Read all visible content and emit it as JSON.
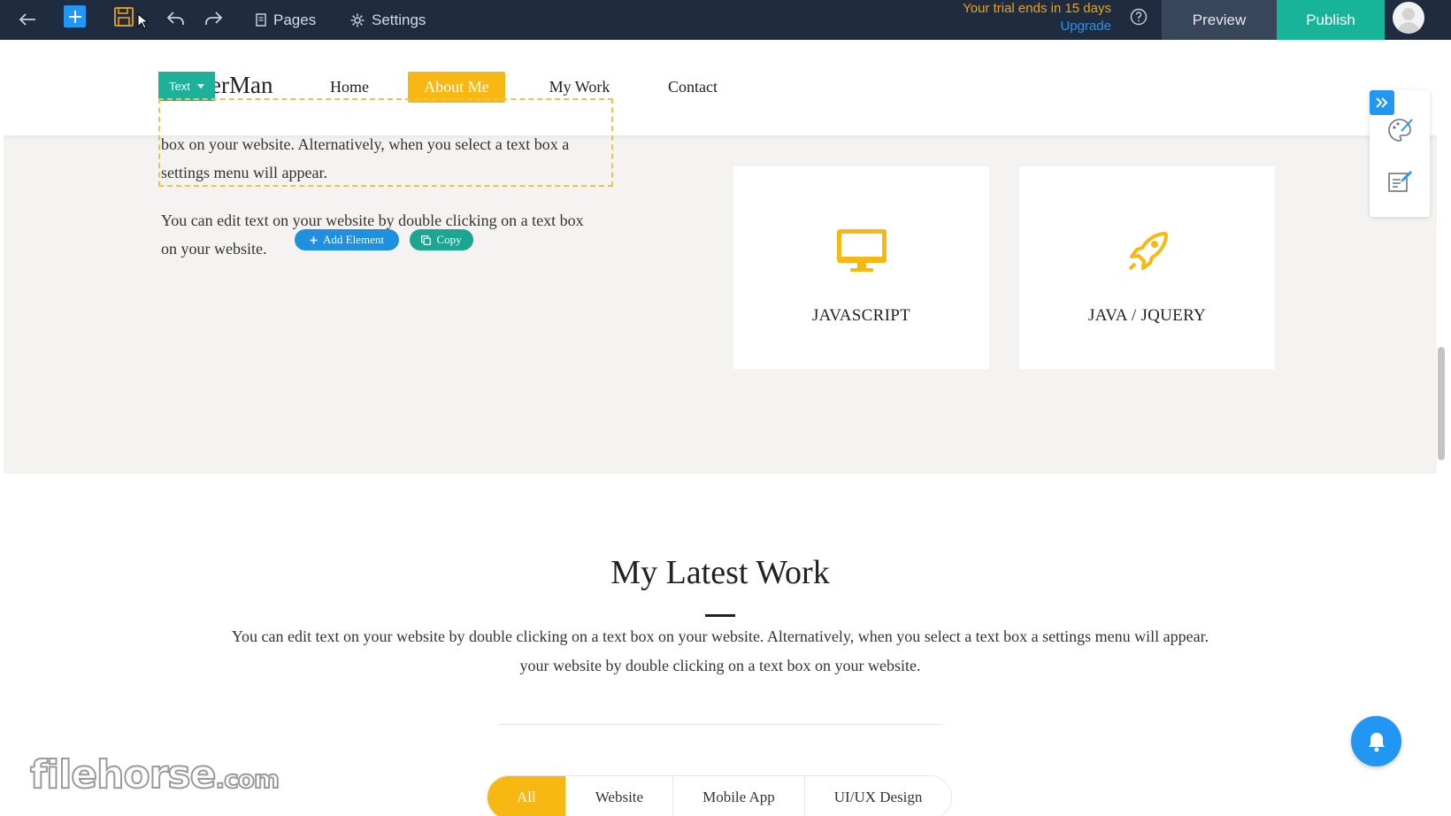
{
  "toolbar": {
    "pages_label": "Pages",
    "settings_label": "Settings",
    "trial_text": "Your trial ends in 15 days",
    "upgrade_label": "Upgrade",
    "preview_label": "Preview",
    "publish_label": "Publish"
  },
  "header": {
    "brand": "erMan",
    "element_tag": "Text",
    "nav": [
      "Home",
      "About Me",
      "My Work",
      "Contact"
    ],
    "active_nav": "About Me"
  },
  "about": {
    "selected_text": "box on your website. Alternatively, when you select a text box a settings menu will appear.",
    "body_text": "You can edit text on your website by double clicking on a text box on your website.",
    "add_element_label": "Add Element",
    "copy_label": "Copy",
    "skills": [
      {
        "title": "JAVASCRIPT",
        "icon": "monitor-icon"
      },
      {
        "title": "JAVA / JQUERY",
        "icon": "rocket-icon"
      }
    ]
  },
  "work": {
    "title": "My Latest Work",
    "text_line1": "You can edit text on your website by double clicking on a text box on your website. Alternatively, when you select a text box a settings menu will appear.",
    "text_line2": "your website by double clicking on a text box on your website.",
    "filters": [
      "All",
      "Website",
      "Mobile App",
      "UI/UX Design"
    ],
    "active_filter": "All"
  },
  "watermark": {
    "brand": "filehorse",
    "suffix": ".com"
  },
  "colors": {
    "toolbar_bg": "#1f2b3e",
    "accent_yellow": "#f7b813",
    "accent_blue": "#2196f3",
    "accent_green": "#18b49a",
    "section_bg": "#f4f3f2"
  }
}
